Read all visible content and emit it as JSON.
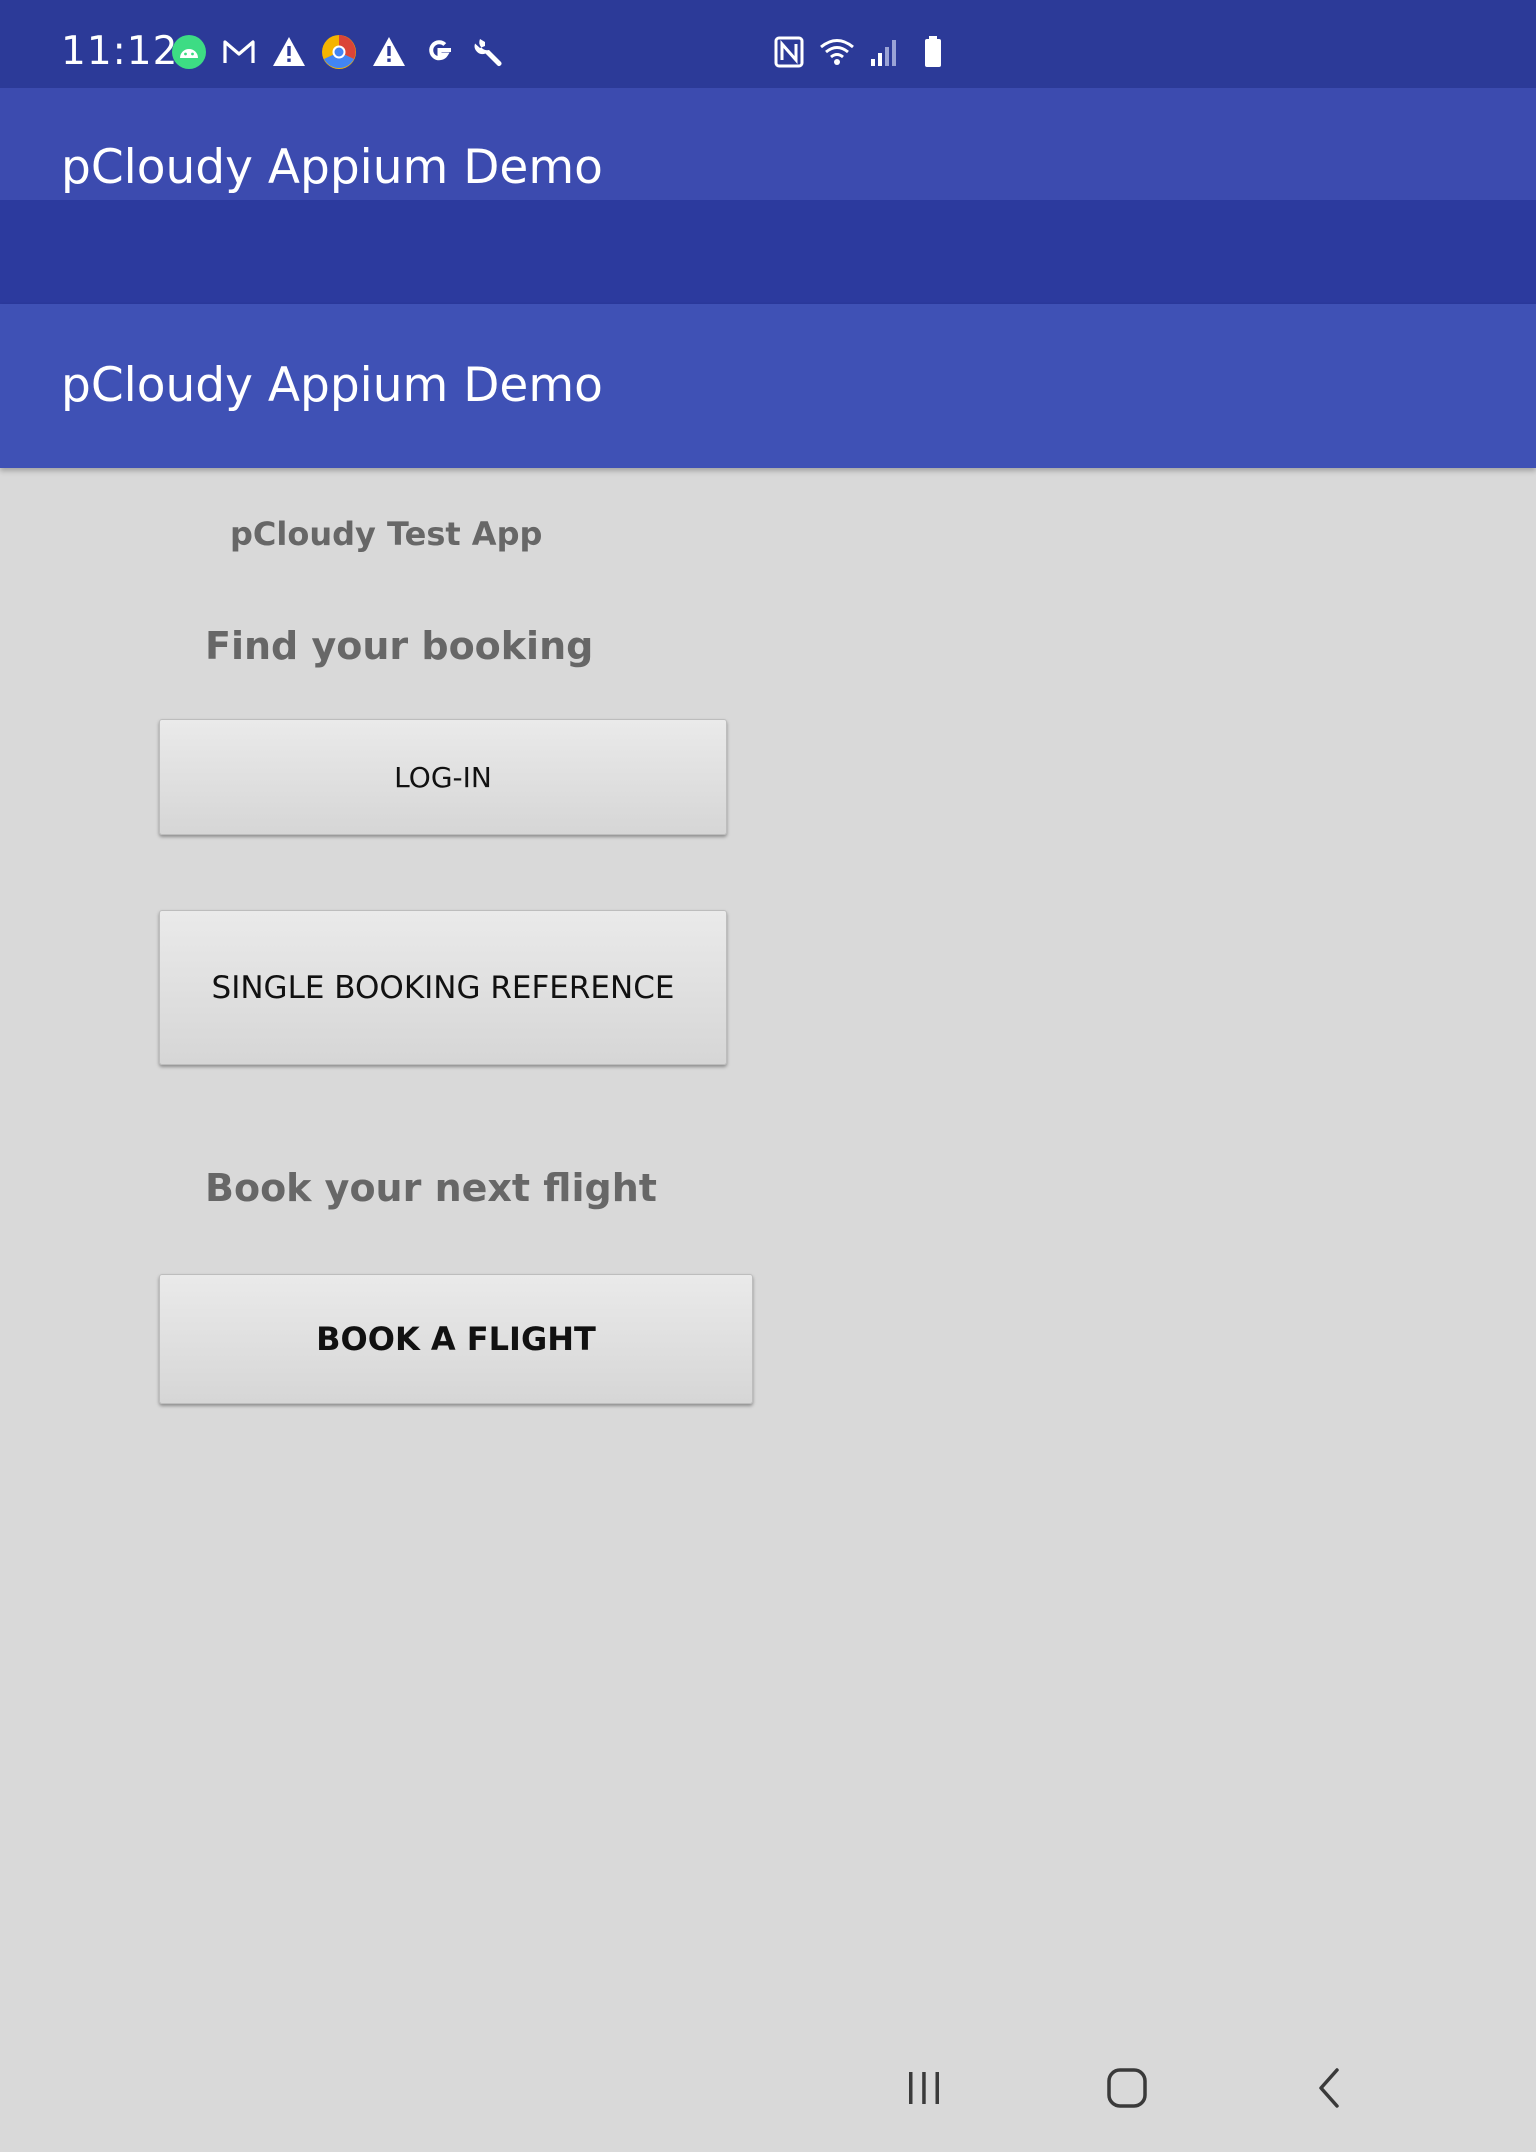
{
  "status_bar": {
    "time": "11:12",
    "left_icons": [
      "android-icon",
      "gmail-icon",
      "warning-icon",
      "chrome-canary-icon",
      "warning-icon",
      "google-icon",
      "wrench-icon"
    ],
    "right_icons": [
      "nfc-icon",
      "wifi-icon",
      "signal-icon",
      "battery-icon"
    ]
  },
  "ghost_toolbar": {
    "title": "pCloudy Appium Demo"
  },
  "toolbar": {
    "title": "pCloudy Appium Demo"
  },
  "main": {
    "app_name": "pCloudy Test App",
    "find_heading": "Find your booking",
    "login_button": "LOG-IN",
    "single_booking_button": "SINGLE BOOKING REFERENCE",
    "book_heading": "Book your next flight",
    "book_flight_button": "BOOK A FLIGHT"
  },
  "nav_bar": {
    "buttons": [
      "recent-apps-icon",
      "home-icon",
      "back-icon"
    ]
  },
  "colors": {
    "status_bar": "#2c3a98",
    "toolbar": "#3f51b5",
    "background": "#d9d9d9",
    "secondary_text": "#676767"
  }
}
